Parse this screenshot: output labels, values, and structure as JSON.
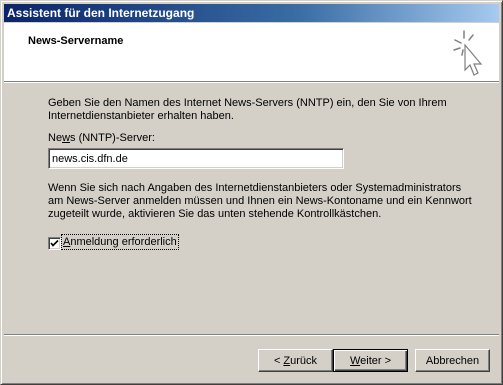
{
  "window": {
    "title": "Assistent für den Internetzugang"
  },
  "header": {
    "title": "News-Servername",
    "icon": "wizard-sparkle-cursor-icon"
  },
  "intro_text": "Geben Sie den Namen des Internet News-Servers (NNTP) ein, den Sie von Ihrem Internetdienstanbieter erhalten haben.",
  "server_field": {
    "label_prefix": "Ne",
    "label_mnemonic": "w",
    "label_suffix": "s (NNTP)-Server:",
    "value": "news.cis.dfn.de"
  },
  "info_text": "Wenn Sie sich nach Angaben des Internetdienstanbieters oder Systemadministrators am News-Server anmelden müssen und Ihnen ein News-Kontoname und ein Kennwort zugeteilt wurde, aktivieren Sie das unten stehende Kontrollkästchen.",
  "login_checkbox": {
    "checked": true,
    "label_mnemonic": "A",
    "label_rest": "nmeldung erforderlich"
  },
  "buttons": {
    "back_prefix": "< ",
    "back_mnemonic": "Z",
    "back_rest": "urück",
    "next_mnemonic": "W",
    "next_rest": "eiter >",
    "cancel": "Abbrechen"
  },
  "colors": {
    "titlebar_start": "#0a246a",
    "titlebar_end": "#a6caf0",
    "face": "#d4d0c8"
  }
}
